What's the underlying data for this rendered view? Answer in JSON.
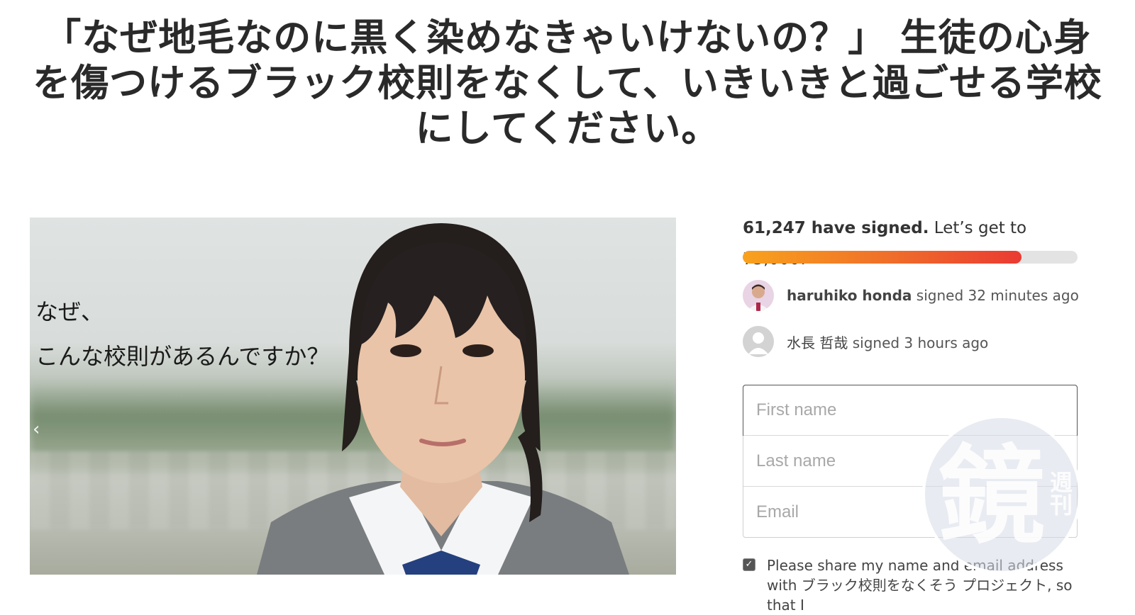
{
  "petition": {
    "title": "「なぜ地毛なのに黒く染めなきゃいけないの？」 生徒の心身を傷つけるブラック校則をなくして、いきいきと過ごせる学校にしてください。"
  },
  "hero": {
    "text_line1": "なぜ、",
    "text_line2": "こんな校則があるんですか？",
    "prev_glyph": "‹"
  },
  "signatures": {
    "count_text": "61,247 have signed.",
    "goal_text": "Let’s get to 75,000!",
    "progress_fraction": 0.833
  },
  "recent_signers": [
    {
      "name": "haruhiko honda",
      "action": "signed 32 minutes ago"
    },
    {
      "name": "水長 哲哉",
      "action": "signed 3 hours ago"
    }
  ],
  "form": {
    "first_name_placeholder": "First name",
    "last_name_placeholder": "Last name",
    "email_placeholder": "Email",
    "consent_checked": true,
    "consent_text": "Please share my name and email address with ブラック校則をなくそう プロジェクト, so that I"
  },
  "watermark": {
    "main_char": "鏡",
    "sub_chars": "週刊"
  },
  "colors": {
    "progress_start": "#f9a21d",
    "progress_end": "#ea3a32",
    "progress_track": "#e3e3e3"
  }
}
